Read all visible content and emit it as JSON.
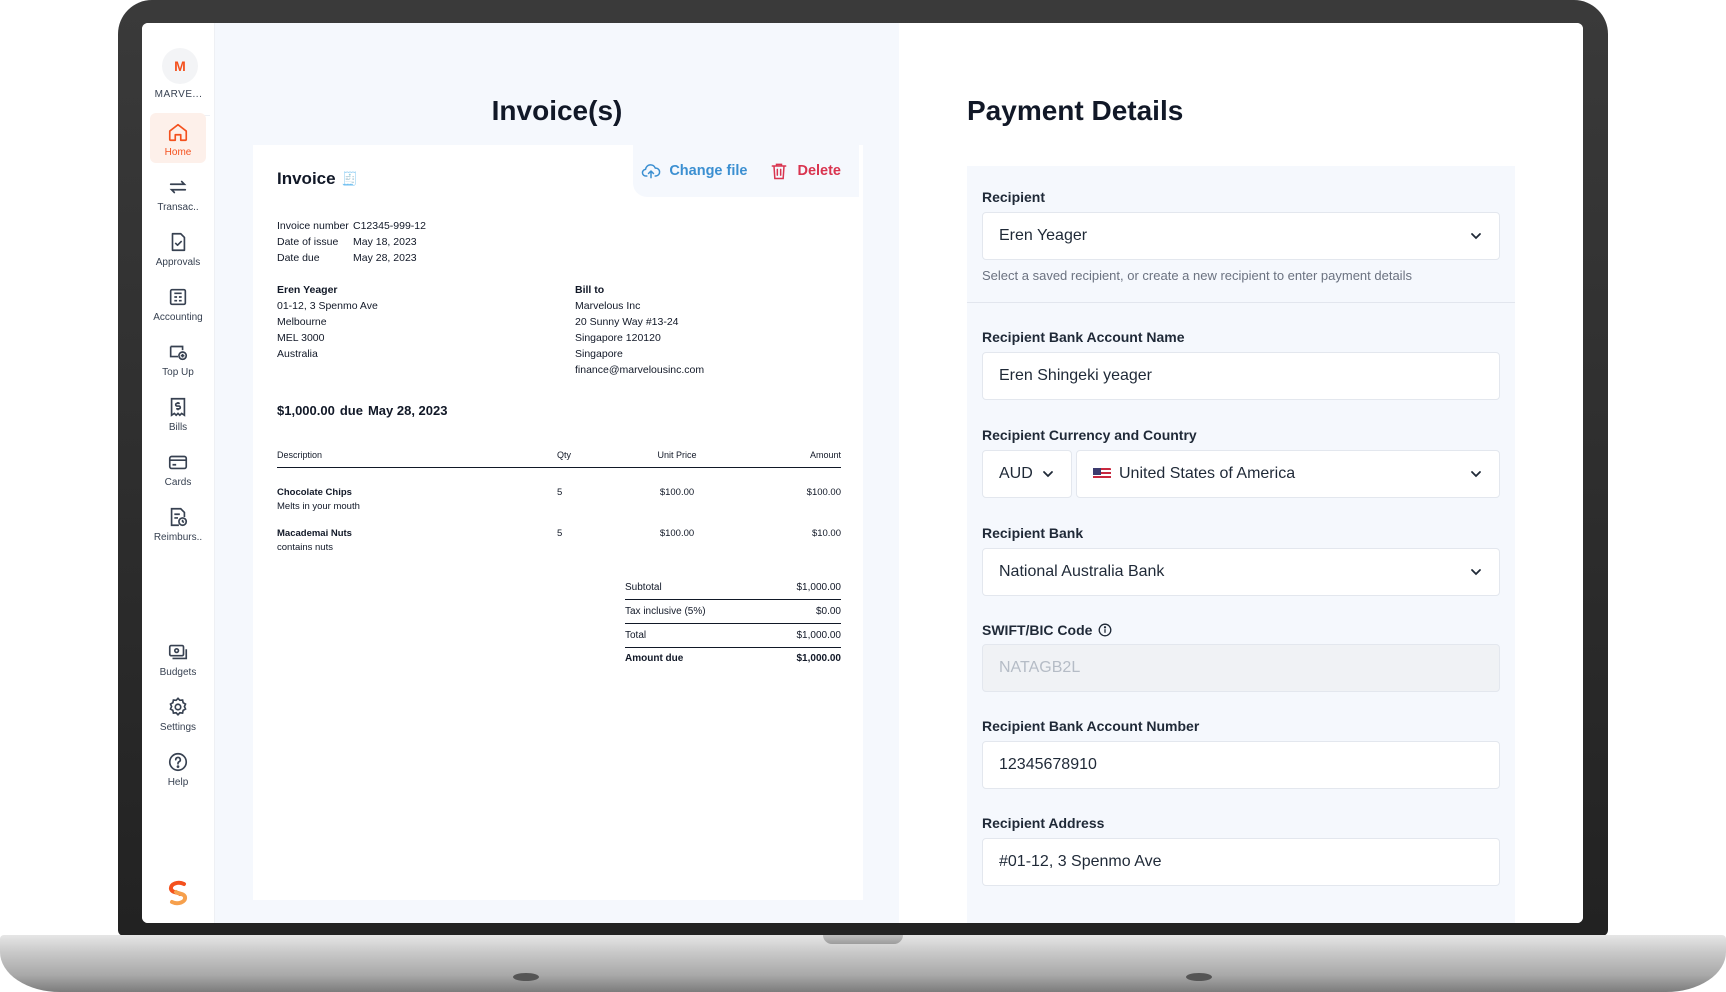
{
  "sidebar": {
    "org_initial": "M",
    "org_name": "MARVE...",
    "items": [
      {
        "label": "Home",
        "icon": "home-icon",
        "active": true
      },
      {
        "label": "Transac..",
        "icon": "transfer-icon"
      },
      {
        "label": "Approvals",
        "icon": "approval-icon"
      },
      {
        "label": "Accounting",
        "icon": "accounting-icon"
      },
      {
        "label": "Top Up",
        "icon": "topup-icon"
      },
      {
        "label": "Bills",
        "icon": "bills-icon"
      },
      {
        "label": "Cards",
        "icon": "card-icon"
      },
      {
        "label": "Reimburs..",
        "icon": "reimburse-icon"
      }
    ],
    "bottom_items": [
      {
        "label": "Budgets",
        "icon": "budgets-icon"
      },
      {
        "label": "Settings",
        "icon": "gear-icon"
      },
      {
        "label": "Help",
        "icon": "help-icon"
      }
    ]
  },
  "invoice_panel": {
    "title": "Invoice(s)",
    "change_file_label": "Change file",
    "delete_label": "Delete"
  },
  "invoice": {
    "title": "Invoice",
    "meta": [
      {
        "label": "Invoice number",
        "value": "C12345-999-12"
      },
      {
        "label": "Date of issue",
        "value": "May 18, 2023"
      },
      {
        "label": "Date due",
        "value": "May 28, 2023"
      }
    ],
    "from": {
      "name": "Eren Yeager",
      "lines": [
        "01-12, 3 Spenmo Ave",
        "Melbourne",
        "MEL 3000",
        "Australia"
      ]
    },
    "bill_to": {
      "heading": "Bill to",
      "lines": [
        "Marvelous Inc",
        "20 Sunny Way #13-24",
        "Singapore 120120",
        "Singapore",
        "finance@marvelousinc.com"
      ]
    },
    "due_amount": "$1,000.00",
    "due_word": "due",
    "due_date": "May 28, 2023",
    "columns": {
      "description": "Description",
      "qty": "Qty",
      "unit_price": "Unit Price",
      "amount": "Amount"
    },
    "items": [
      {
        "name": "Chocolate Chips",
        "note": "Melts in your mouth",
        "qty": "5",
        "unit_price": "$100.00",
        "amount": "$100.00"
      },
      {
        "name": "Macademai Nuts",
        "note": "contains nuts",
        "qty": "5",
        "unit_price": "$100.00",
        "amount": "$10.00"
      }
    ],
    "totals": [
      {
        "label": "Subtotal",
        "value": "$1,000.00"
      },
      {
        "label": "Tax inclusive (5%)",
        "value": "$0.00"
      },
      {
        "label": "Total",
        "value": "$1,000.00"
      },
      {
        "label": "Amount due",
        "value": "$1,000.00"
      }
    ]
  },
  "payment": {
    "title": "Payment Details",
    "recipient_label": "Recipient",
    "recipient_value": "Eren Yeager",
    "recipient_helper": "Select a saved recipient, or create a new recipient to enter payment details",
    "account_name_label": "Recipient Bank Account Name",
    "account_name_value": "Eren Shingeki yeager",
    "currency_country_label": "Recipient Currency and Country",
    "currency_value": "AUD",
    "country_value": "United States of America",
    "bank_label": "Recipient Bank",
    "bank_value": "National Australia Bank",
    "swift_label": "SWIFT/BIC Code",
    "swift_value": "NATAGB2L",
    "account_number_label": "Recipient Bank Account Number",
    "account_number_value": "12345678910",
    "address_label": "Recipient Address",
    "address_value": "#01-12, 3 Spenmo Ave"
  },
  "colors": {
    "accent": "#f4511e",
    "link_blue": "#3b8fd1",
    "delete_red": "#d9344f",
    "panel_bg": "#f5f8fd"
  }
}
